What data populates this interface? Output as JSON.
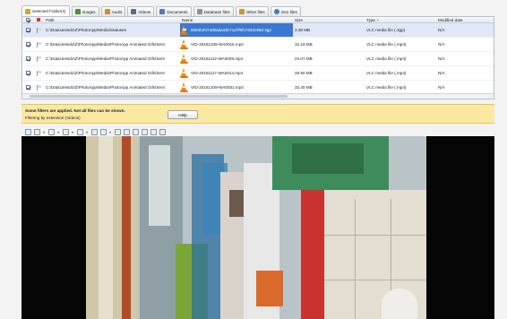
{
  "tabs": [
    {
      "label": "Selected Folder(s)",
      "icon": "folder-icon",
      "color": "#d7a43c"
    },
    {
      "label": "Images",
      "icon": "images-icon",
      "color": "#4f8f3a"
    },
    {
      "label": "Audio",
      "icon": "audio-icon",
      "color": "#c2913c"
    },
    {
      "label": "Videos",
      "icon": "video-icon",
      "color": "#5b6b86"
    },
    {
      "label": "Documents",
      "icon": "documents-icon",
      "color": "#5a77b3"
    },
    {
      "label": "Database files",
      "icon": "database-icon",
      "color": "#8c8f95"
    },
    {
      "label": "Other files",
      "icon": "other-files-icon",
      "color": "#c9962f"
    },
    {
      "label": "Geo files",
      "icon": "globe-icon",
      "color": "#3a7fc4"
    }
  ],
  "columns": {
    "path": "Path",
    "name": "Name",
    "size": "Size",
    "type": "Type",
    "modified": "Modified date"
  },
  "rows": [
    {
      "path": "C:\\Data\\Jessdo\\Z\\PhotoApp\\Media\\Statuses",
      "name": "6564b4074d6ada19c71d7f0fc7632c96d.3gp",
      "size": "3.38 MB",
      "type": "VLC media file (.3gp)",
      "modified": "N/A",
      "selected": true
    },
    {
      "path": "C:\\Data\\Jessdo\\Z\\PhotoApp\\Media\\PhotoApp Animated Gifs\\Sent",
      "name": "VID-20161236-WA0015.mp4",
      "size": "15.18 MB",
      "type": "VLC media file (.mp4)",
      "modified": "N/A",
      "selected": false
    },
    {
      "path": "C:\\Data\\Jessdo\\Z\\PhotoApp\\Media\\PhotoApp Animated Gifs\\Sent",
      "name": "VID-20161112-WA0028.mp4",
      "size": "23.07 MB",
      "type": "VLC media file (.mp4)",
      "modified": "N/A",
      "selected": false
    },
    {
      "path": "C:\\Data\\Jessdo\\Z\\PhotoApp\\Media\\PhotoApp Animated Gifs\\Sent",
      "name": "VID-20161117-WA0014.mp4",
      "size": "28.90 MB",
      "type": "VLC media file (.mp4)",
      "modified": "N/A",
      "selected": false
    },
    {
      "path": "C:\\Data\\Jessdo\\Z\\PhotoApp\\Media\\PhotoApp Animated Gifs\\Sent",
      "name": "VID-20161209-WA0031.mp4",
      "size": "33.40 MB",
      "type": "VLC media file (.mp4)",
      "modified": "N/A",
      "selected": false
    }
  ],
  "banner": {
    "title": "Some filters are applied. Not all files can be shown.",
    "detail": "Filtering by extension (Videos)",
    "help_label": "Help"
  },
  "toolbar_icons": [
    "fit-icon",
    "zoom-icon",
    "rotate-icon",
    "text-icon",
    "grid-icon",
    "export-icon",
    "copy-icon",
    "save-icon",
    "print-icon",
    "search-icon",
    "undo-icon",
    "settings-icon",
    "window-icon"
  ],
  "colors": {
    "selection": "#3a78d4",
    "banner": "#fbe9a3",
    "accent_cone": "#f08a00"
  }
}
